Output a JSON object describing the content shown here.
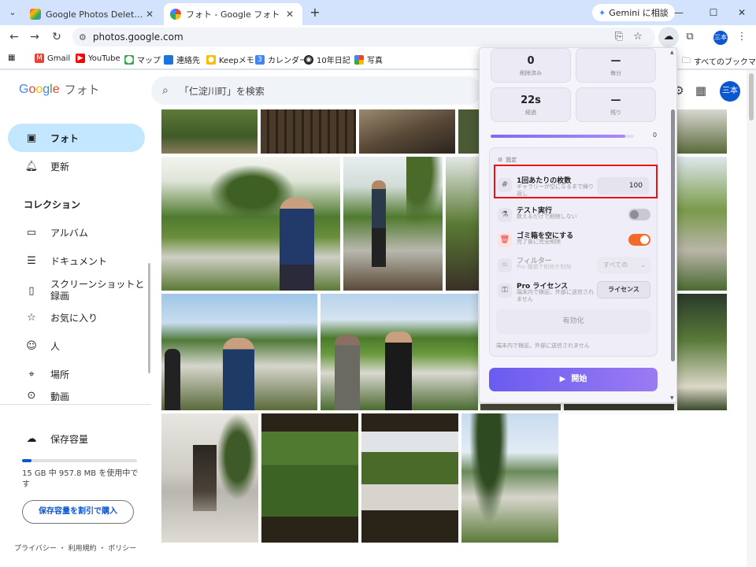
{
  "browser": {
    "tabs": [
      {
        "title": "Google Photos Delete Tool - Ch"
      },
      {
        "title": "フォト - Google フォト"
      }
    ],
    "gemini_label": "Gemini に相談",
    "url": "photos.google.com",
    "profile_initials": "三本",
    "bookmarks": [
      "Gmail",
      "YouTube",
      "マップ",
      "連絡先",
      "Keepメモ",
      "カレンダー",
      "10年日記",
      "写真"
    ],
    "all_bookmarks_label": "すべてのブックマーク"
  },
  "photos": {
    "logo": {
      "google": "Google",
      "product": "フォト"
    },
    "search_placeholder": "「仁淀川町」を検索",
    "avatar_initials": "三本",
    "nav": {
      "photos": "フォト",
      "updates": "更新",
      "collections_heading": "コレクション",
      "albums": "アルバム",
      "documents": "ドキュメント",
      "screenshots": "スクリーンショットと録画",
      "favorites": "お気に入り",
      "people": "人",
      "places": "場所",
      "videos": "動画"
    },
    "storage": {
      "label": "保存容量",
      "usage_text": "15 GB 中 957.8 MB を使用中です",
      "used_fraction": 0.08,
      "buy_label": "保存容量を割引で購入"
    },
    "footer": "プライバシー ・ 利用規約 ・ ポリシー"
  },
  "extension": {
    "stats": [
      {
        "value": "0",
        "label": "削除済み"
      },
      {
        "value": "—",
        "label": "毎分"
      },
      {
        "value": "22s",
        "label": "経過"
      },
      {
        "value": "—",
        "label": "残り"
      }
    ],
    "progress_fraction": 0.94,
    "progress_value": "0",
    "settings_heading": "設定",
    "batch": {
      "title": "1回あたりの枚数",
      "sub": "ギャラリーが空になるまで繰り返し",
      "value": "100"
    },
    "test_run": {
      "title": "テスト実行",
      "sub": "数えるだけで削除しない",
      "on": false
    },
    "empty_trash": {
      "title": "ゴミ箱を空にする",
      "sub": "完了後に完全削除",
      "on": true
    },
    "filter": {
      "title": "フィルター",
      "sub": "Pro 種類で削除を制限",
      "selected": "すべての"
    },
    "license": {
      "title": "Pro ライセンス",
      "sub": "端末内で検証。外部に送信されません",
      "button": "ライセンス"
    },
    "enable_label": "有効化",
    "footer_note": "端末内で検証。外部に送信されません",
    "start_label": "開始",
    "colors": {
      "accent": "#7b6cf6",
      "toggle_on": "#f06a2a",
      "highlight": "#ee1111"
    }
  }
}
